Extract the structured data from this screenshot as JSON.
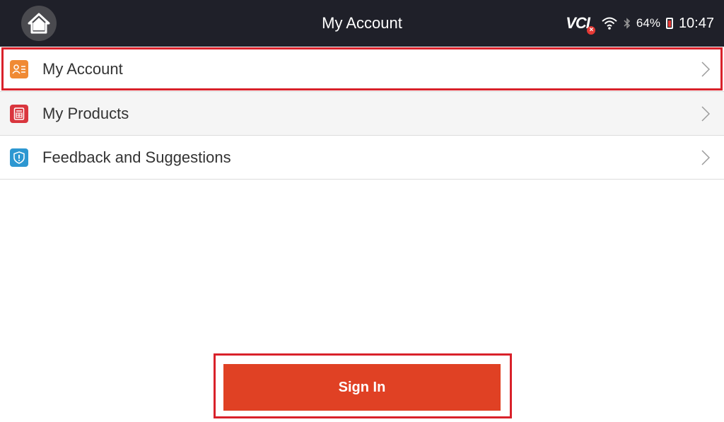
{
  "header": {
    "title": "My Account",
    "status": {
      "vci_label": "VCI",
      "battery_percent": "64%",
      "time": "10:47"
    }
  },
  "menu": {
    "items": [
      {
        "label": "My Account",
        "icon": "account-icon",
        "icon_color": "#f08a34"
      },
      {
        "label": "My Products",
        "icon": "products-icon",
        "icon_color": "#d9363e"
      },
      {
        "label": "Feedback and Suggestions",
        "icon": "feedback-icon",
        "icon_color": "#2d97d1"
      }
    ]
  },
  "actions": {
    "sign_in_label": "Sign In"
  },
  "colors": {
    "topbar": "#1f2029",
    "accent": "#e04124",
    "highlight": "#d9212a"
  }
}
